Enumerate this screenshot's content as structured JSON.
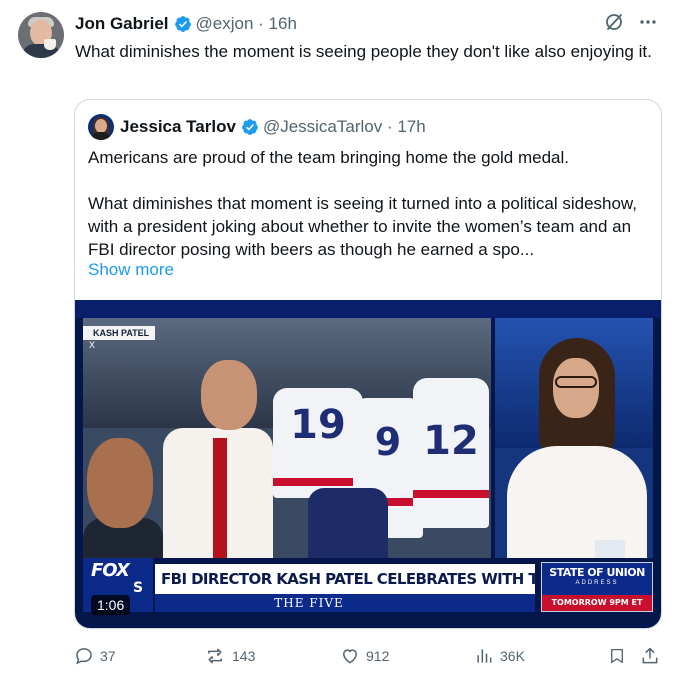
{
  "tweet": {
    "author_name": "Jon Gabriel",
    "author_handle": "@exjon",
    "time": "16h",
    "text": "What diminishes the moment is seeing people they don't like also enjoying it."
  },
  "quote": {
    "author_name": "Jessica Tarlov",
    "author_handle": "@JessicaTarlov",
    "time": "17h",
    "paragraph_1": "Americans are proud of the team bringing home the gold medal.",
    "paragraph_2": "What diminishes that moment is seeing it turned into a political sideshow, with a president joking about whether to invite the women’s team and an FBI director posing with beers as though he earned a spo...",
    "show_more": "Show more",
    "video": {
      "corner_label": "KASH PATEL",
      "corner_x": "X",
      "jersey_1": "19",
      "jersey_2": "9",
      "jersey_3": "12",
      "fox_logo_top": "FOX",
      "fox_logo_sub": "S",
      "headline": "FBI DIRECTOR KASH PATEL CELEBRATES WITH TEAM USA",
      "show_name": "THE FIVE",
      "sotu_title": "STATE OF UNION",
      "sotu_sub": "ADDRESS",
      "sotu_time": "TOMORROW 9PM ET",
      "duration": "1:06"
    }
  },
  "actions": {
    "replies": "37",
    "reposts": "143",
    "likes": "912",
    "views": "36K"
  },
  "colors": {
    "accent": "#1d9bf0",
    "secondary_text": "#536471",
    "border": "#cfd9de"
  }
}
